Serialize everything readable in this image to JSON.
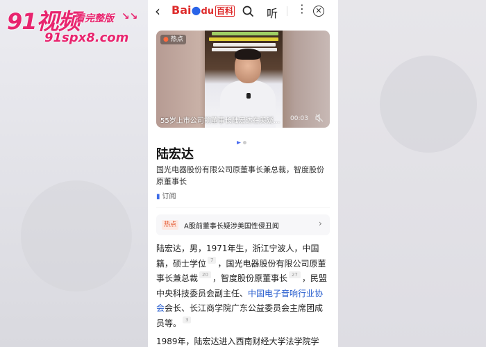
{
  "watermark": {
    "brand": "91视频",
    "tag": "看完整版",
    "arrows": "↘↘",
    "url": "91spx8.com"
  },
  "topbar": {
    "logo_bai": "Bai",
    "logo_du": "du",
    "logo_baike": "百科",
    "listen_label": "听",
    "more_icon": "⋮",
    "close_icon": "✕"
  },
  "video": {
    "hot_label": "热点",
    "title": "55岁上市公司前董事长陆宏达在美疑...",
    "time": "00:03",
    "mute_icon": "🔇"
  },
  "entry": {
    "name": "陆宏达",
    "subtitle": "国光电器股份有限公司原董事长兼总裁，智度股份原董事长",
    "subscribe_label": "订阅"
  },
  "hot_news": {
    "tag": "热点",
    "text": "A股前董事长疑涉美国性侵丑闻",
    "arrow": "›"
  },
  "body": {
    "p1_a": "陆宏达，男，1971年生，浙江宁波人，中国籍，硕士学位",
    "ref1": "7",
    "p1_b": "，国光电器股份有限公司原董事长兼总裁",
    "ref2": "20",
    "p1_c": "，智度股份原董事长",
    "ref3": "27",
    "p1_d": "，民盟中央科技委员会副主任、",
    "link": "中国电子音响行业协会",
    "p1_e": "会长、长江商学院广东公益委员会主席团成员等。",
    "ref4": "3",
    "p2": "1989年，陆宏达进入西南财经大学法学院学"
  }
}
